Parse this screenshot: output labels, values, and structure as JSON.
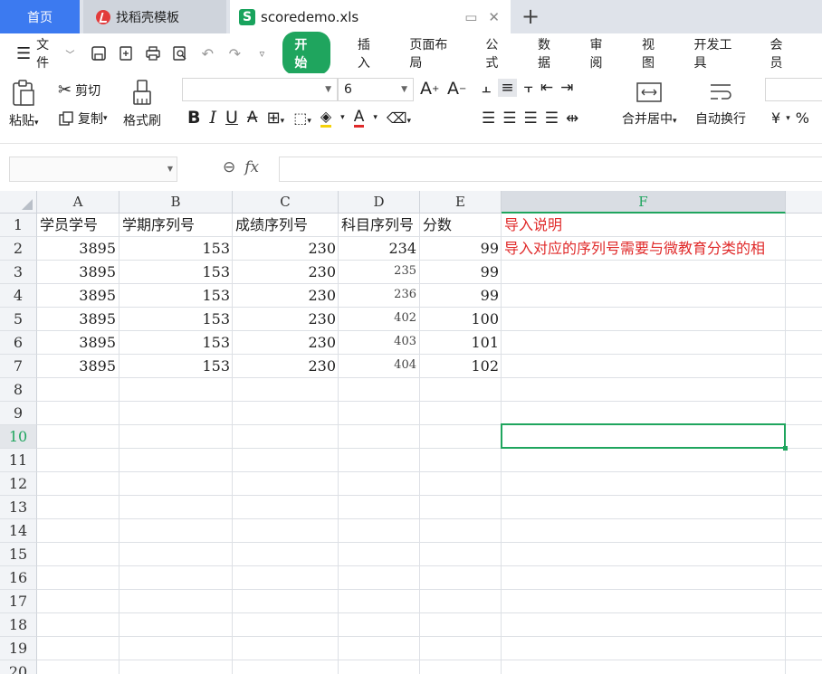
{
  "tabs": {
    "home": "首页",
    "template": "找稻壳模板",
    "doc": "scoredemo.xls"
  },
  "menu": {
    "file": "文件",
    "items": [
      "开始",
      "插入",
      "页面布局",
      "公式",
      "数据",
      "审阅",
      "视图",
      "开发工具",
      "会员"
    ]
  },
  "ribbon": {
    "paste": "粘贴",
    "cut": "剪切",
    "copy": "复制",
    "format_painter": "格式刷",
    "font_name": "",
    "font_size": "6",
    "merge_center": "合并居中",
    "wrap_text": "自动换行",
    "currency": "¥",
    "percent": "%"
  },
  "formula_bar": {
    "name_box": "",
    "fx": "fx",
    "content": ""
  },
  "sheet": {
    "columns": [
      "A",
      "B",
      "C",
      "D",
      "E",
      "F"
    ],
    "selected_column": "F",
    "rows": [
      "1",
      "2",
      "3",
      "4",
      "5",
      "6",
      "7",
      "8",
      "9",
      "10",
      "11",
      "12",
      "13",
      "14",
      "15",
      "16",
      "17",
      "18",
      "19",
      "20"
    ],
    "selected_row": "10",
    "header": [
      "学员学号",
      "学期序列号",
      "成绩序列号",
      "科目序列号",
      "分数"
    ],
    "data": [
      [
        "3895",
        "153",
        "230",
        "234",
        "99"
      ],
      [
        "3895",
        "153",
        "230",
        "235",
        "99"
      ],
      [
        "3895",
        "153",
        "230",
        "236",
        "99"
      ],
      [
        "3895",
        "153",
        "230",
        "402",
        "100"
      ],
      [
        "3895",
        "153",
        "230",
        "403",
        "101"
      ],
      [
        "3895",
        "153",
        "230",
        "404",
        "102"
      ]
    ],
    "note_title": "导入说明",
    "note_text": "导入对应的序列号需要与微教育分类的相",
    "accent": "#1fa55e",
    "note_color": "#e02a2a"
  }
}
